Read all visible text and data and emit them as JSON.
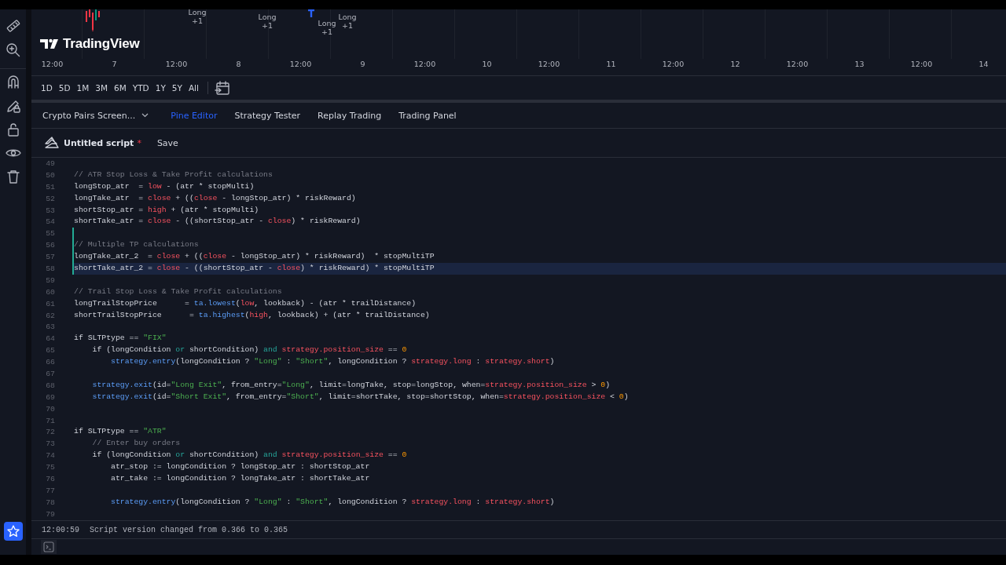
{
  "chart": {
    "logo": "TradingView",
    "markers": [
      {
        "label": "Long",
        "count": "+1"
      },
      {
        "label": "Long",
        "count": "+1"
      },
      {
        "label": "Long",
        "count": "+1"
      },
      {
        "label": "Long",
        "count": "+1"
      }
    ],
    "x_axis": [
      "12:00",
      "7",
      "12:00",
      "8",
      "12:00",
      "9",
      "12:00",
      "10",
      "12:00",
      "11",
      "12:00",
      "12",
      "12:00",
      "13",
      "12:00",
      "14"
    ]
  },
  "ranges": [
    "1D",
    "5D",
    "1M",
    "3M",
    "6M",
    "YTD",
    "1Y",
    "5Y",
    "All"
  ],
  "panel_tabs": {
    "script_menu": "Crypto Pairs Screen...",
    "tabs": [
      {
        "label": "Pine Editor",
        "selected": true
      },
      {
        "label": "Strategy Tester",
        "selected": false
      },
      {
        "label": "Replay Trading",
        "selected": false
      },
      {
        "label": "Trading Panel",
        "selected": false
      }
    ]
  },
  "script": {
    "title": "Untitled script",
    "unsaved_mark": "*",
    "save": "Save"
  },
  "editor": {
    "lines": [
      {
        "number": "49",
        "current": false,
        "modified": false
      },
      {
        "number": "50",
        "tokens": [
          {
            "text": "// ATR Stop Loss & Take Profit calculations",
            "kind": "comment"
          }
        ],
        "current": false,
        "modified": false
      },
      {
        "number": "51",
        "tokens": [
          {
            "text": "longStop_atr  = "
          },
          {
            "text": "low",
            "kind": "builtin"
          },
          {
            "text": " - (atr * stopMulti)"
          }
        ],
        "current": false,
        "modified": false
      },
      {
        "number": "52",
        "tokens": [
          {
            "text": "longTake_atr  = "
          },
          {
            "text": "close",
            "kind": "builtin"
          },
          {
            "text": " + (("
          },
          {
            "text": "close",
            "kind": "builtin"
          },
          {
            "text": " - longStop_atr) * riskReward)"
          }
        ],
        "current": false,
        "modified": false
      },
      {
        "number": "53",
        "tokens": [
          {
            "text": "shortStop_atr = "
          },
          {
            "text": "high",
            "kind": "builtin"
          },
          {
            "text": " + (atr * stopMulti)"
          }
        ],
        "current": false,
        "modified": false
      },
      {
        "number": "54",
        "tokens": [
          {
            "text": "shortTake_atr = "
          },
          {
            "text": "close",
            "kind": "builtin"
          },
          {
            "text": " - ((shortStop_atr - "
          },
          {
            "text": "close",
            "kind": "builtin"
          },
          {
            "text": ") * riskReward)"
          }
        ],
        "current": false,
        "modified": false
      },
      {
        "number": "55",
        "current": false,
        "modified": true
      },
      {
        "number": "56",
        "tokens": [
          {
            "text": "// Multiple TP calculations",
            "kind": "comment"
          }
        ],
        "current": false,
        "modified": true
      },
      {
        "number": "57",
        "tokens": [
          {
            "text": "longTake_atr_2  = "
          },
          {
            "text": "close",
            "kind": "builtin"
          },
          {
            "text": " + (("
          },
          {
            "text": "close",
            "kind": "builtin"
          },
          {
            "text": " - longStop_atr) * riskReward)  * stopMultiTP"
          }
        ],
        "current": false,
        "modified": true
      },
      {
        "number": "58",
        "tokens": [
          {
            "text": "shortTake_atr_2 = "
          },
          {
            "text": "close",
            "kind": "builtin"
          },
          {
            "text": " - ((shortStop_atr - "
          },
          {
            "text": "close",
            "kind": "builtin"
          },
          {
            "text": ") * riskReward) * stopMultiTP"
          }
        ],
        "current": true,
        "modified": true
      },
      {
        "number": "59",
        "current": false,
        "modified": false
      },
      {
        "number": "60",
        "tokens": [
          {
            "text": "// Trail Stop Loss & Take Profit calculations",
            "kind": "comment"
          }
        ],
        "current": false,
        "modified": false
      },
      {
        "number": "61",
        "tokens": [
          {
            "text": "longTrailStopPrice      = "
          },
          {
            "text": "ta.lowest",
            "kind": "function"
          },
          {
            "text": "("
          },
          {
            "text": "low",
            "kind": "builtin"
          },
          {
            "text": ", lookback) - (atr * trailDistance)"
          }
        ],
        "current": false,
        "modified": false
      },
      {
        "number": "62",
        "tokens": [
          {
            "text": "shortTrailStopPrice      = "
          },
          {
            "text": "ta.highest",
            "kind": "function"
          },
          {
            "text": "("
          },
          {
            "text": "high",
            "kind": "builtin"
          },
          {
            "text": ", lookback) + (atr * trailDistance)"
          }
        ],
        "current": false,
        "modified": false
      },
      {
        "number": "63",
        "current": false,
        "modified": false
      },
      {
        "number": "64",
        "tokens": [
          {
            "text": "if SLTPtype == "
          },
          {
            "text": "\"FIX\"",
            "kind": "string"
          }
        ],
        "current": false,
        "modified": false
      },
      {
        "number": "65",
        "tokens": [
          {
            "text": "    if (longCondition "
          },
          {
            "text": "or",
            "kind": "keyword"
          },
          {
            "text": " shortCondition) "
          },
          {
            "text": "and",
            "kind": "keyword"
          },
          {
            "text": " strategy.position_size",
            "kind": "builtin"
          },
          {
            "text": " == "
          },
          {
            "text": "0",
            "kind": "number"
          }
        ],
        "current": false,
        "modified": false
      },
      {
        "number": "66",
        "tokens": [
          {
            "text": "        strategy.entry",
            "kind": "function"
          },
          {
            "text": "(longCondition ? "
          },
          {
            "text": "\"Long\"",
            "kind": "string"
          },
          {
            "text": " : "
          },
          {
            "text": "\"Short\"",
            "kind": "string"
          },
          {
            "text": ", longCondition ? "
          },
          {
            "text": "strategy.long",
            "kind": "builtin"
          },
          {
            "text": " : "
          },
          {
            "text": "strategy.short",
            "kind": "builtin"
          },
          {
            "text": ")"
          }
        ],
        "current": false,
        "modified": false
      },
      {
        "number": "67",
        "current": false,
        "modified": false
      },
      {
        "number": "68",
        "tokens": [
          {
            "text": "    strategy.exit",
            "kind": "function"
          },
          {
            "text": "(id="
          },
          {
            "text": "\"Long Exit\"",
            "kind": "string"
          },
          {
            "text": ", from_entry="
          },
          {
            "text": "\"Long\"",
            "kind": "string"
          },
          {
            "text": ", limit=longTake, stop=longStop, when="
          },
          {
            "text": "strategy.position_size",
            "kind": "builtin"
          },
          {
            "text": " > "
          },
          {
            "text": "0",
            "kind": "number"
          },
          {
            "text": ")"
          }
        ],
        "current": false,
        "modified": false
      },
      {
        "number": "69",
        "tokens": [
          {
            "text": "    strategy.exit",
            "kind": "function"
          },
          {
            "text": "(id="
          },
          {
            "text": "\"Short Exit\"",
            "kind": "string"
          },
          {
            "text": ", from_entry="
          },
          {
            "text": "\"Short\"",
            "kind": "string"
          },
          {
            "text": ", limit=shortTake, stop=shortStop, when="
          },
          {
            "text": "strategy.position_size",
            "kind": "builtin"
          },
          {
            "text": " < "
          },
          {
            "text": "0",
            "kind": "number"
          },
          {
            "text": ")"
          }
        ],
        "current": false,
        "modified": false
      },
      {
        "number": "70",
        "current": false,
        "modified": false
      },
      {
        "number": "71",
        "current": false,
        "modified": false
      },
      {
        "number": "72",
        "tokens": [
          {
            "text": "if SLTPtype == "
          },
          {
            "text": "\"ATR\"",
            "kind": "string"
          }
        ],
        "current": false,
        "modified": false
      },
      {
        "number": "73",
        "tokens": [
          {
            "text": "    // Enter buy orders",
            "kind": "comment"
          }
        ],
        "current": false,
        "modified": false
      },
      {
        "number": "74",
        "tokens": [
          {
            "text": "    if (longCondition "
          },
          {
            "text": "or",
            "kind": "keyword"
          },
          {
            "text": " shortCondition) "
          },
          {
            "text": "and",
            "kind": "keyword"
          },
          {
            "text": " strategy.position_size",
            "kind": "builtin"
          },
          {
            "text": " == "
          },
          {
            "text": "0",
            "kind": "number"
          }
        ],
        "current": false,
        "modified": false
      },
      {
        "number": "75",
        "tokens": [
          {
            "text": "        atr_stop := longCondition ? longStop_atr : shortStop_atr"
          }
        ],
        "current": false,
        "modified": false
      },
      {
        "number": "76",
        "tokens": [
          {
            "text": "        atr_take := longCondition ? longTake_atr : shortTake_atr"
          }
        ],
        "current": false,
        "modified": false
      },
      {
        "number": "77",
        "current": false,
        "modified": false
      },
      {
        "number": "78",
        "tokens": [
          {
            "text": "        strategy.entry",
            "kind": "function"
          },
          {
            "text": "(longCondition ? "
          },
          {
            "text": "\"Long\"",
            "kind": "string"
          },
          {
            "text": " : "
          },
          {
            "text": "\"Short\"",
            "kind": "string"
          },
          {
            "text": ", longCondition ? "
          },
          {
            "text": "strategy.long",
            "kind": "builtin"
          },
          {
            "text": " : "
          },
          {
            "text": "strategy.short",
            "kind": "builtin"
          },
          {
            "text": ")"
          }
        ],
        "current": false,
        "modified": false
      },
      {
        "number": "79",
        "current": false,
        "modified": false
      }
    ]
  },
  "console": {
    "time": "12:00:59",
    "message": "Script version changed from 0.366 to 0.365"
  }
}
